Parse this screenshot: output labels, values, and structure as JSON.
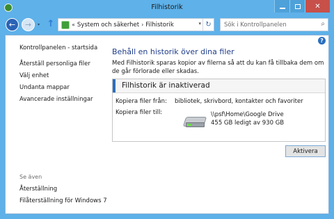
{
  "window": {
    "title": "Filhistorik",
    "controls": {
      "minimize_icon": "minimize-icon",
      "maximize_icon": "maximize-icon",
      "close_label": "✕"
    }
  },
  "address_bar": {
    "breadcrumb_prefix": "«",
    "crumbs": [
      "System och säkerhet",
      "Filhistorik"
    ],
    "separator": "›",
    "search_placeholder": "Sök i Kontrollpanelen"
  },
  "sidebar": {
    "home": "Kontrollpanelen - startsida",
    "items": [
      "Återställ personliga filer",
      "Välj enhet",
      "Undanta mappar",
      "Avancerade inställningar"
    ],
    "see_also_label": "Se även",
    "related": [
      "Återställning",
      "Filåterställning för Windows 7"
    ]
  },
  "main": {
    "heading": "Behåll en historik över dina filer",
    "description": "Med Filhistorik sparas kopior av filerna så att du kan få tillbaka dem om de går förlorade eller skadas.",
    "status_title": "Filhistorik är inaktiverad",
    "copy_from_label": "Kopiera filer från:",
    "copy_from_value": "bibliotek, skrivbord, kontakter och favoriter",
    "copy_to_label": "Kopiera filer till:",
    "drive_path": "\\\\psf\\Home\\Google Drive",
    "drive_space": "455 GB ledigt av 930 GB",
    "activate_button": "Aktivera"
  },
  "colors": {
    "chrome": "#5eb1e9",
    "heading": "#1f3d8a",
    "close": "#c7504a"
  }
}
